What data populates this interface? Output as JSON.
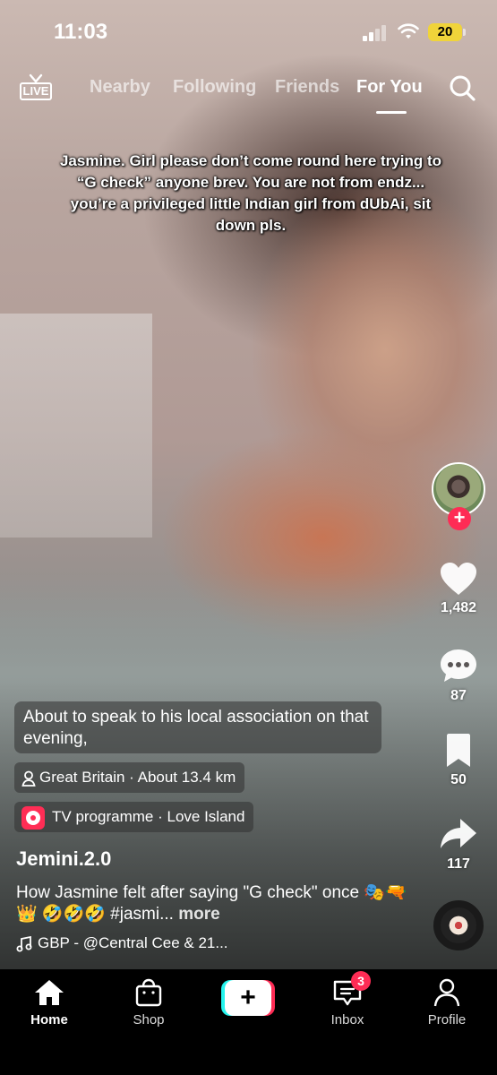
{
  "status_bar": {
    "time": "11:03",
    "battery": "20"
  },
  "top_nav": {
    "live_label": "LIVE",
    "tabs": [
      {
        "label": "Nearby",
        "active": false
      },
      {
        "label": "Following",
        "active": false
      },
      {
        "label": "Friends",
        "active": false
      },
      {
        "label": "For You",
        "active": true
      }
    ]
  },
  "video": {
    "caption_overlay": "Jasmine. Girl please don’t come round here trying to “G check” anyone brev. You are not from endz... you’re a privileged little Indian girl from dUbAi, sit down pls.",
    "story_text": "About to speak to his local association on that evening,",
    "location": "Great Britain",
    "distance": "About 13.4 km",
    "tv_category": "TV programme",
    "tv_show": "Love Island",
    "username": "Jemini.2.0",
    "description": "How Jasmine felt after saying \"G check\" once 🎭🔫👑 🤣🤣🤣 #jasmi...",
    "more_label": "more",
    "sound": "GBP - @Central Cee & 21..."
  },
  "rail": {
    "likes": "1,482",
    "comments": "87",
    "saves": "50",
    "shares": "117",
    "follow_symbol": "+"
  },
  "bottom_nav": {
    "home": "Home",
    "shop": "Shop",
    "create_symbol": "+",
    "inbox": "Inbox",
    "inbox_badge": "3",
    "profile": "Profile"
  },
  "colors": {
    "accent": "#fe2c55",
    "create_left": "#25f4ee",
    "battery": "#f0d43a"
  }
}
